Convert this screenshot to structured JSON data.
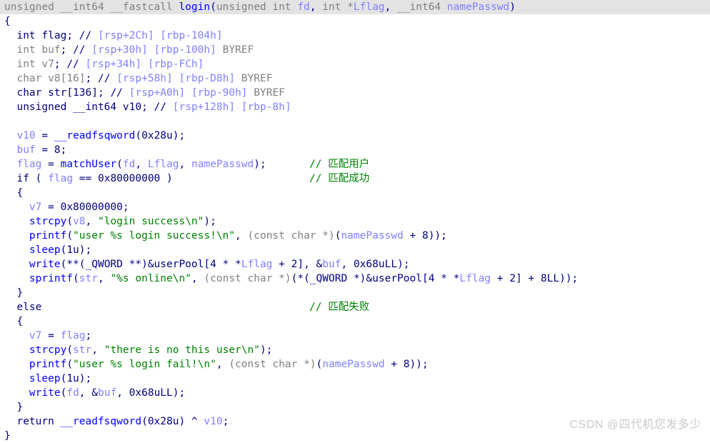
{
  "view": {
    "name": "hex-rays-pseudocode",
    "background": "#ffffff",
    "highlight_color": "#e3e3e3",
    "colors": {
      "keyword": "#000080",
      "function": "#0000ff",
      "local_var": "#8080ff",
      "string": "#008000",
      "comment": "#008000",
      "cast": "#808080"
    }
  },
  "code": {
    "signature": {
      "ret_type": "unsigned __int64",
      "calling_convention": "__fastcall",
      "name": "login",
      "params": "(unsigned int fd, int *Lflag, __int64 namePasswd)"
    },
    "lines": [
      {
        "n": 1,
        "text": "unsigned __int64 __fastcall login(unsigned int fd, int *Lflag, __int64 namePasswd)",
        "highlighted": true
      },
      {
        "n": 2,
        "text": "{"
      },
      {
        "n": 3,
        "text": "  int flag; // [rsp+2Ch] [rbp-104h]"
      },
      {
        "n": 4,
        "text": "  int buf; // [rsp+30h] [rbp-100h] BYREF"
      },
      {
        "n": 5,
        "text": "  int v7; // [rsp+34h] [rbp-FCh]"
      },
      {
        "n": 6,
        "text": "  char v8[16]; // [rsp+58h] [rbp-D8h] BYREF"
      },
      {
        "n": 7,
        "text": "  char str[136]; // [rsp+A0h] [rbp-90h] BYREF"
      },
      {
        "n": 8,
        "text": "  unsigned __int64 v10; // [rsp+128h] [rbp-8h]"
      },
      {
        "n": 9,
        "text": ""
      },
      {
        "n": 10,
        "text": "  v10 = __readfsqword(0x28u);"
      },
      {
        "n": 11,
        "text": "  buf = 8;"
      },
      {
        "n": 12,
        "text": "  flag = matchUser(fd, Lflag, namePasswd);",
        "comment": "// 匹配用户"
      },
      {
        "n": 13,
        "text": "  if ( flag == 0x80000000 )",
        "comment": "// 匹配成功"
      },
      {
        "n": 14,
        "text": "  {"
      },
      {
        "n": 15,
        "text": "    v7 = 0x80000000;"
      },
      {
        "n": 16,
        "text": "    strcpy(v8, \"login success\\n\");"
      },
      {
        "n": 17,
        "text": "    printf(\"user %s login success!\\n\", (const char *)(namePasswd + 8));"
      },
      {
        "n": 18,
        "text": "    sleep(1u);"
      },
      {
        "n": 19,
        "text": "    write(**(_QWORD **)&userPool[4 * *Lflag + 2], &buf, 0x68uLL);"
      },
      {
        "n": 20,
        "text": "    sprintf(str, \"%s online\\n\", (const char *)(*(_QWORD *)&userPool[4 * *Lflag + 2] + 8LL));"
      },
      {
        "n": 21,
        "text": "  }"
      },
      {
        "n": 22,
        "text": "  else",
        "comment": "// 匹配失败"
      },
      {
        "n": 23,
        "text": "  {"
      },
      {
        "n": 24,
        "text": "    v7 = flag;"
      },
      {
        "n": 25,
        "text": "    strcpy(str, \"there is no this user\\n\");"
      },
      {
        "n": 26,
        "text": "    printf(\"user %s login fail!\\n\", (const char *)(namePasswd + 8));"
      },
      {
        "n": 27,
        "text": "    sleep(1u);"
      },
      {
        "n": 28,
        "text": "    write(fd, &buf, 0x68uLL);"
      },
      {
        "n": 29,
        "text": "  }"
      },
      {
        "n": 30,
        "text": "  return __readfsqword(0x28u) ^ v10;"
      },
      {
        "n": 31,
        "text": "}"
      }
    ],
    "comments": {
      "match_user": "// 匹配用户",
      "match_success": "// 匹配成功",
      "match_fail": "// 匹配失败"
    },
    "variables": [
      {
        "decl": "int flag;",
        "stack": "[rsp+2Ch] [rbp-104h]",
        "byref": ""
      },
      {
        "decl": "int buf;",
        "stack": "[rsp+30h] [rbp-100h]",
        "byref": "BYREF"
      },
      {
        "decl": "int v7;",
        "stack": "[rsp+34h] [rbp-FCh]",
        "byref": ""
      },
      {
        "decl": "char v8[16];",
        "stack": "[rsp+58h] [rbp-D8h]",
        "byref": "BYREF"
      },
      {
        "decl": "char str[136];",
        "stack": "[rsp+A0h] [rbp-90h]",
        "byref": "BYREF"
      },
      {
        "decl": "unsigned __int64 v10;",
        "stack": "[rsp+128h] [rbp-8h]",
        "byref": ""
      }
    ]
  },
  "watermark": {
    "text": "CSDN @四代机您发多少"
  }
}
